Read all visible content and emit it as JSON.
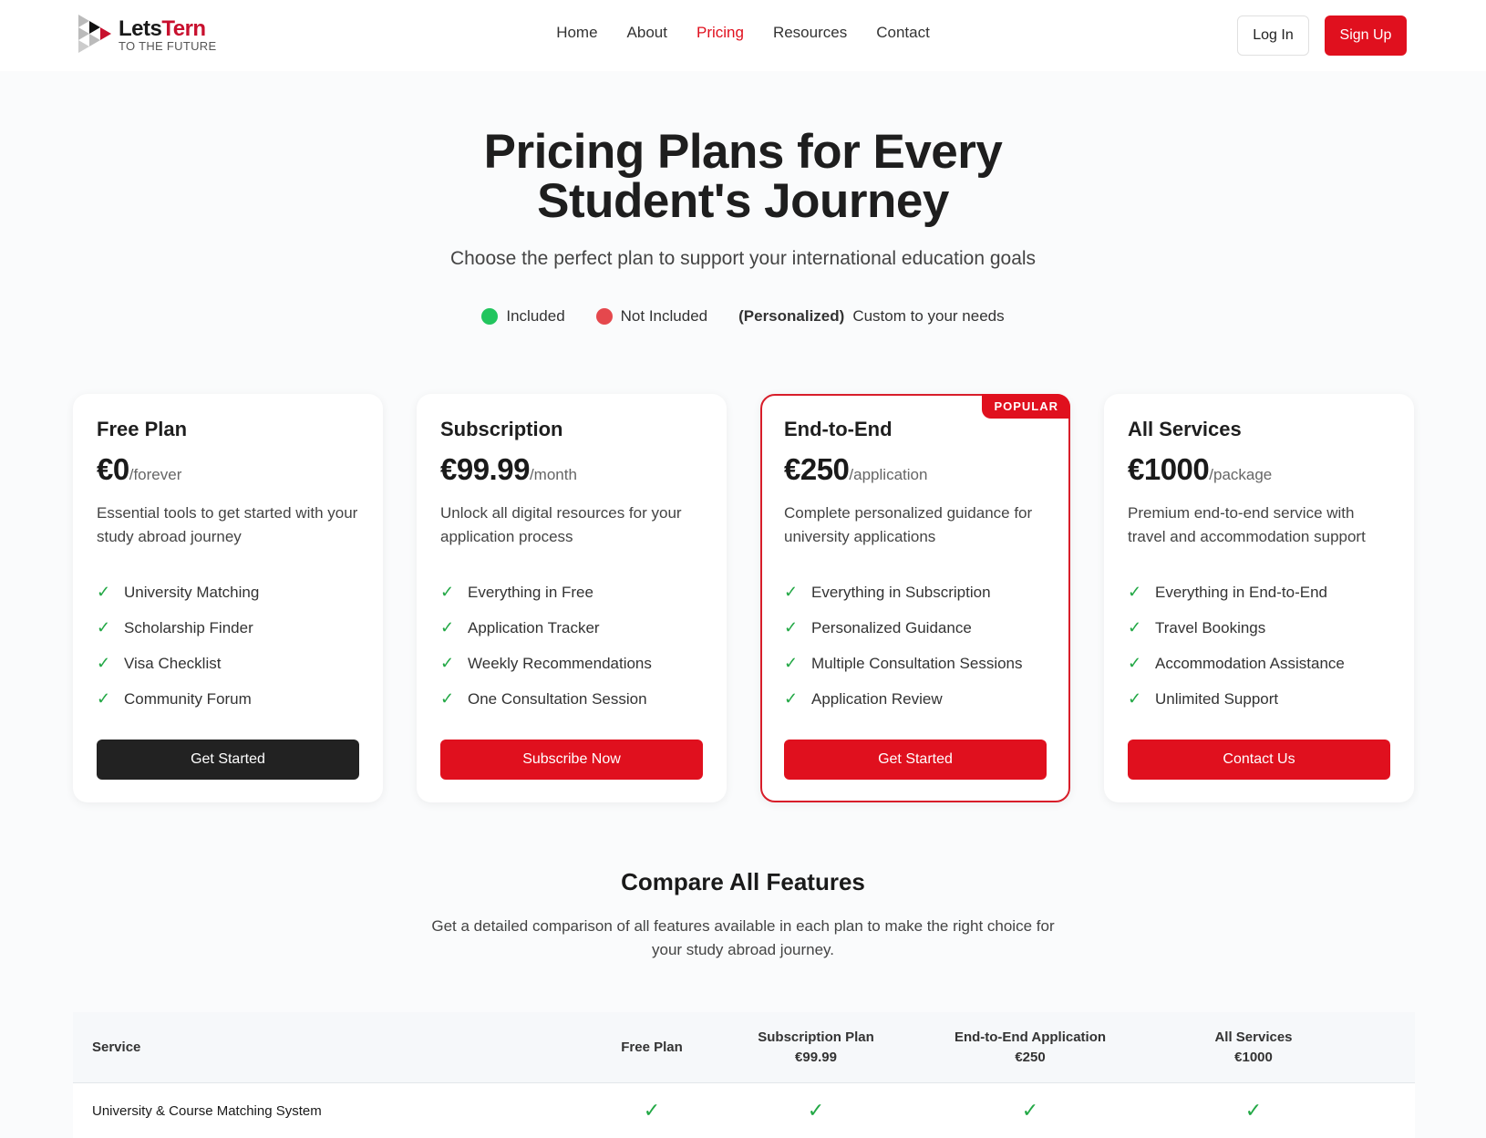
{
  "brand": {
    "name_part1": "Lets",
    "name_part2": "Tern",
    "tagline": "TO THE FUTURE"
  },
  "nav": {
    "items": [
      "Home",
      "About",
      "Pricing",
      "Resources",
      "Contact"
    ],
    "active": "Pricing"
  },
  "auth": {
    "login": "Log In",
    "signup": "Sign Up"
  },
  "hero": {
    "title": "Pricing Plans for Every Student's Journey",
    "subtitle": "Choose the perfect plan to support your international education goals"
  },
  "legend": {
    "included": "Included",
    "not_included": "Not Included",
    "personalized_tag": "(Personalized)",
    "personalized_desc": "Custom to your needs",
    "colors": {
      "included": "#22c55e",
      "not_included": "#e5484d"
    }
  },
  "plans": [
    {
      "name": "Free Plan",
      "price": "€0",
      "period": "/forever",
      "desc": "Essential tools to get started with your study abroad journey",
      "features": [
        "University Matching",
        "Scholarship Finder",
        "Visa Checklist",
        "Community Forum"
      ],
      "cta": "Get Started"
    },
    {
      "name": "Subscription",
      "price": "€99.99",
      "period": "/month",
      "desc": "Unlock all digital resources for your application process",
      "features": [
        "Everything in Free",
        "Application Tracker",
        "Weekly Recommendations",
        "One Consultation Session"
      ],
      "cta": "Subscribe Now"
    },
    {
      "name": "End-to-End",
      "price": "€250",
      "period": "/application",
      "desc": "Complete personalized guidance for university applications",
      "features": [
        "Everything in Subscription",
        "Personalized Guidance",
        "Multiple Consultation Sessions",
        "Application Review"
      ],
      "cta": "Get Started",
      "badge": "POPULAR"
    },
    {
      "name": "All Services",
      "price": "€1000",
      "period": "/package",
      "desc": "Premium end-to-end service with travel and accommodation support",
      "features": [
        "Everything in End-to-End",
        "Travel Bookings",
        "Accommodation Assistance",
        "Unlimited Support"
      ],
      "cta": "Contact Us"
    }
  ],
  "compare": {
    "title": "Compare All Features",
    "desc": "Get a detailed comparison of all features available in each plan to make the right choice for your study abroad journey.",
    "headers": [
      {
        "name": "Service"
      },
      {
        "name": "Free Plan"
      },
      {
        "name": "Subscription Plan",
        "price": "€99.99"
      },
      {
        "name": "End-to-End Application",
        "price": "€250"
      },
      {
        "name": "All Services",
        "price": "€1000"
      }
    ],
    "rows": [
      {
        "service": "University & Course Matching System",
        "values": [
          "✓",
          "✓",
          "✓",
          "✓"
        ]
      }
    ]
  }
}
